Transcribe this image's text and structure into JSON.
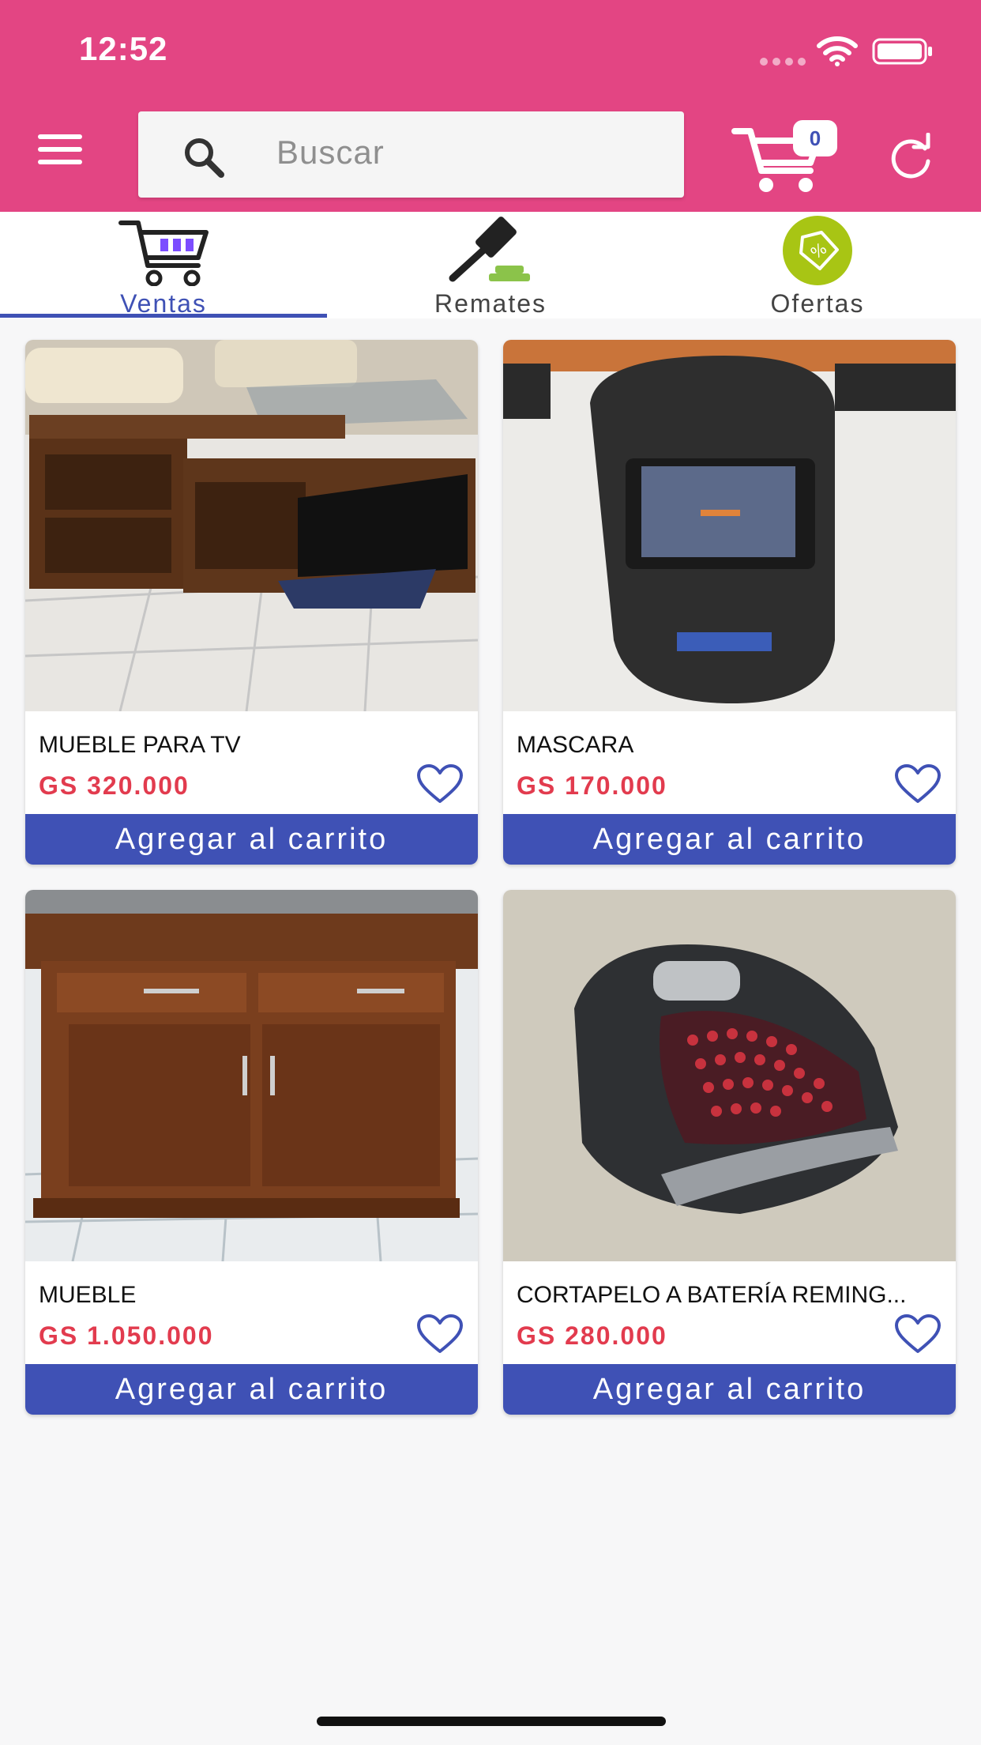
{
  "status_bar": {
    "time": "12:52"
  },
  "header": {
    "menu_icon": "hamburger-menu-icon",
    "search_placeholder": "Buscar",
    "cart_count": "0",
    "cart_icon": "shopping-cart-icon",
    "refresh_icon": "refresh-icon",
    "background_color": "#e34583"
  },
  "tabs": [
    {
      "label": "Ventas",
      "icon": "cart-icon",
      "active": true
    },
    {
      "label": "Remates",
      "icon": "gavel-icon",
      "active": false
    },
    {
      "label": "Ofertas",
      "icon": "discount-tag-icon",
      "active": false
    }
  ],
  "products": [
    {
      "title": "MUEBLE PARA TV",
      "price": "GS 320.000",
      "button": "Agregar al carrito",
      "image": "tv-stand-photo"
    },
    {
      "title": "MASCARA",
      "price": "GS 170.000",
      "button": "Agregar al carrito",
      "image": "welding-mask-photo"
    },
    {
      "title": "MUEBLE",
      "price": "GS 1.050.000",
      "button": "Agregar al carrito",
      "image": "wooden-cabinet-photo"
    },
    {
      "title": "CORTAPELO A BATERÍA REMING...",
      "price": "GS 280.000",
      "button": "Agregar al carrito",
      "image": "hair-trimmer-photo"
    }
  ],
  "colors": {
    "accent": "#3f51b5",
    "price": "#e23b4e"
  }
}
